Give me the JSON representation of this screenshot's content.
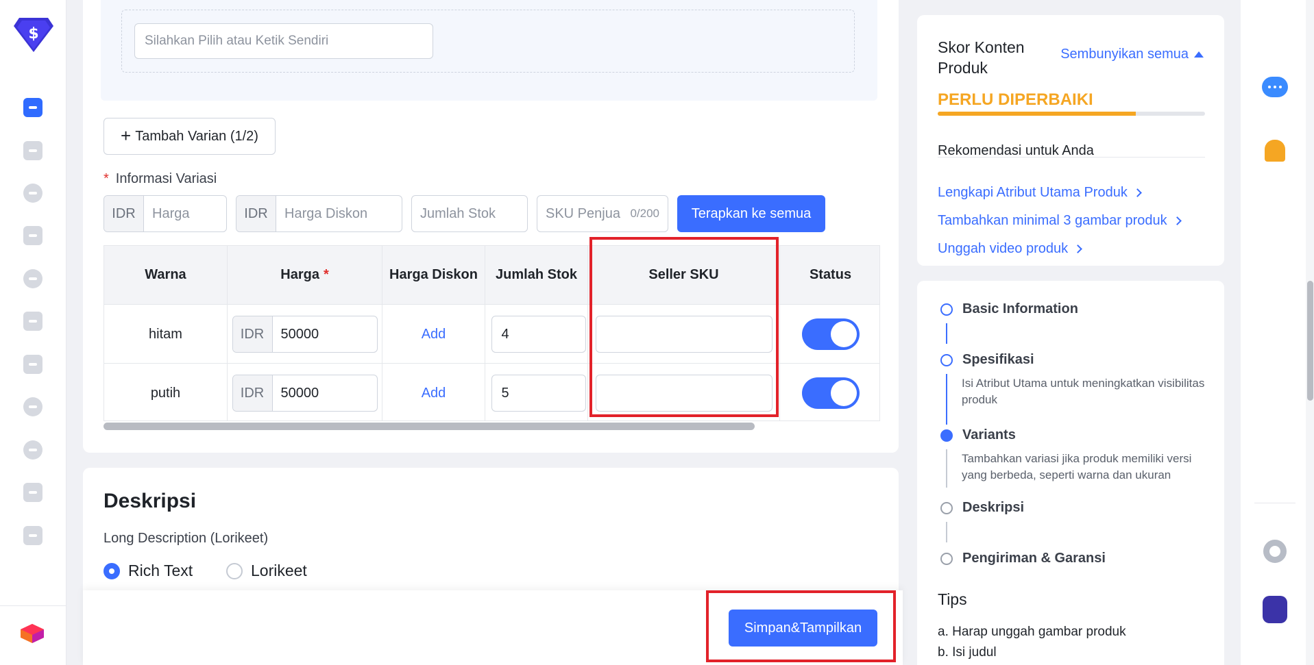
{
  "nav": {
    "icons": [
      "app-logo",
      "products-icon",
      "orders-icon",
      "analytics-icon",
      "reports-icon",
      "promotions-icon",
      "chat-icon",
      "store-icon",
      "finance-icon",
      "help-icon",
      "account-icon",
      "documents-icon",
      "lazada-brand"
    ]
  },
  "variants": {
    "option_placeholder": "Silahkan Pilih atau Ketik Sendiri",
    "add_variant_label": "Tambah Varian (1/2)",
    "info_label": "Informasi Variasi",
    "currency": "IDR",
    "price_placeholder": "Harga",
    "discount_placeholder": "Harga Diskon",
    "stock_placeholder": "Jumlah Stok",
    "sku_placeholder": "SKU Penjua",
    "sku_counter": "0/200",
    "apply_all": "Terapkan ke semua",
    "columns": [
      "Warna",
      "Harga",
      "Harga Diskon",
      "Jumlah Stok",
      "Seller SKU",
      "Status"
    ],
    "rows": [
      {
        "color": "hitam",
        "price": "50000",
        "discount": "Add",
        "stock": "4",
        "sku": "",
        "active": true
      },
      {
        "color": "putih",
        "price": "50000",
        "discount": "Add",
        "stock": "5",
        "sku": "",
        "active": true
      }
    ]
  },
  "description": {
    "title": "Deskripsi",
    "subtitle": "Long Description (Lorikeet)",
    "options": [
      "Rich Text",
      "Lorikeet"
    ],
    "selected": "Rich Text"
  },
  "footer": {
    "save_label": "Simpan&Tampilkan"
  },
  "score": {
    "title": "Skor Konten Produk",
    "hide_all": "Sembunyikan semua",
    "status": "PERLU DIPERBAIKI",
    "progress": 0.74,
    "recommendation_title": "Rekomendasi untuk Anda",
    "recommendations": [
      "Lengkapi Atribut Utama Produk",
      "Tambahkan minimal 3 gambar produk",
      "Unggah video produk"
    ]
  },
  "steps": {
    "items": [
      {
        "label": "Basic Information",
        "desc": ""
      },
      {
        "label": "Spesifikasi",
        "desc": "Isi Atribut Utama untuk meningkatkan visibilitas produk"
      },
      {
        "label": "Variants",
        "desc": "Tambahkan variasi jika produk memiliki versi yang berbeda, seperti warna dan ukuran"
      },
      {
        "label": "Deskripsi",
        "desc": ""
      },
      {
        "label": "Pengiriman & Garansi",
        "desc": ""
      }
    ],
    "tips_title": "Tips",
    "tips": [
      "a. Harap unggah gambar produk",
      "b. Isi judul"
    ]
  },
  "colors": {
    "accent": "#3a6dff",
    "warning": "#f5a623",
    "highlight": "#e2222a"
  }
}
